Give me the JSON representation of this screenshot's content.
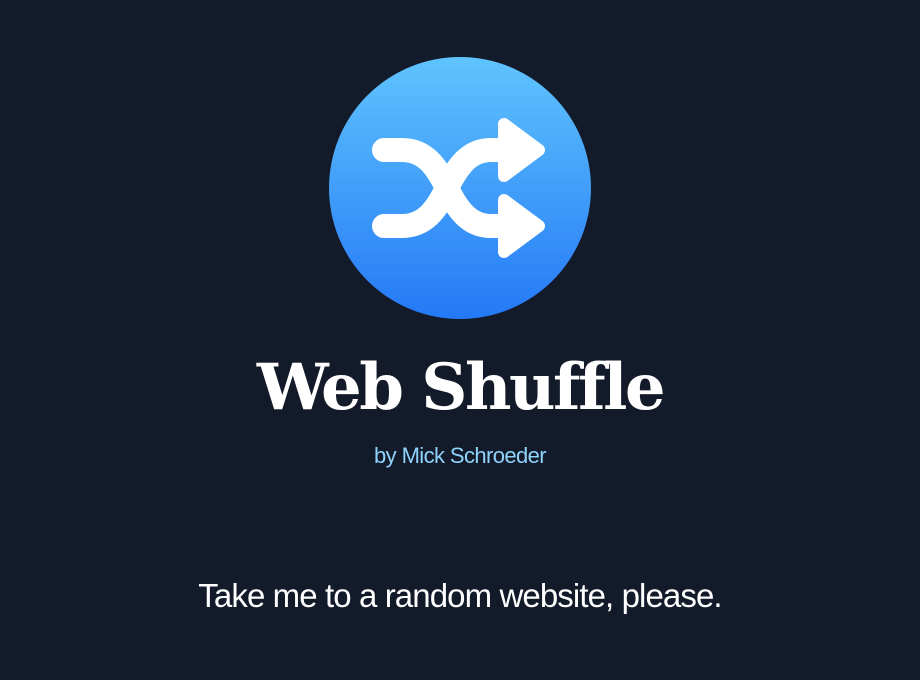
{
  "app": {
    "logo_icon": "shuffle-icon",
    "title": "Web Shuffle",
    "byline_prefix": "by ",
    "author": "Mick Schroeder"
  },
  "cta": {
    "label": "Take me to a random website, please."
  },
  "colors": {
    "background": "#131a29",
    "logo_gradient_top": "#5fc4fd",
    "logo_gradient_bottom": "#2479f6",
    "author_link": "#8fd3fb",
    "text": "#ffffff"
  }
}
